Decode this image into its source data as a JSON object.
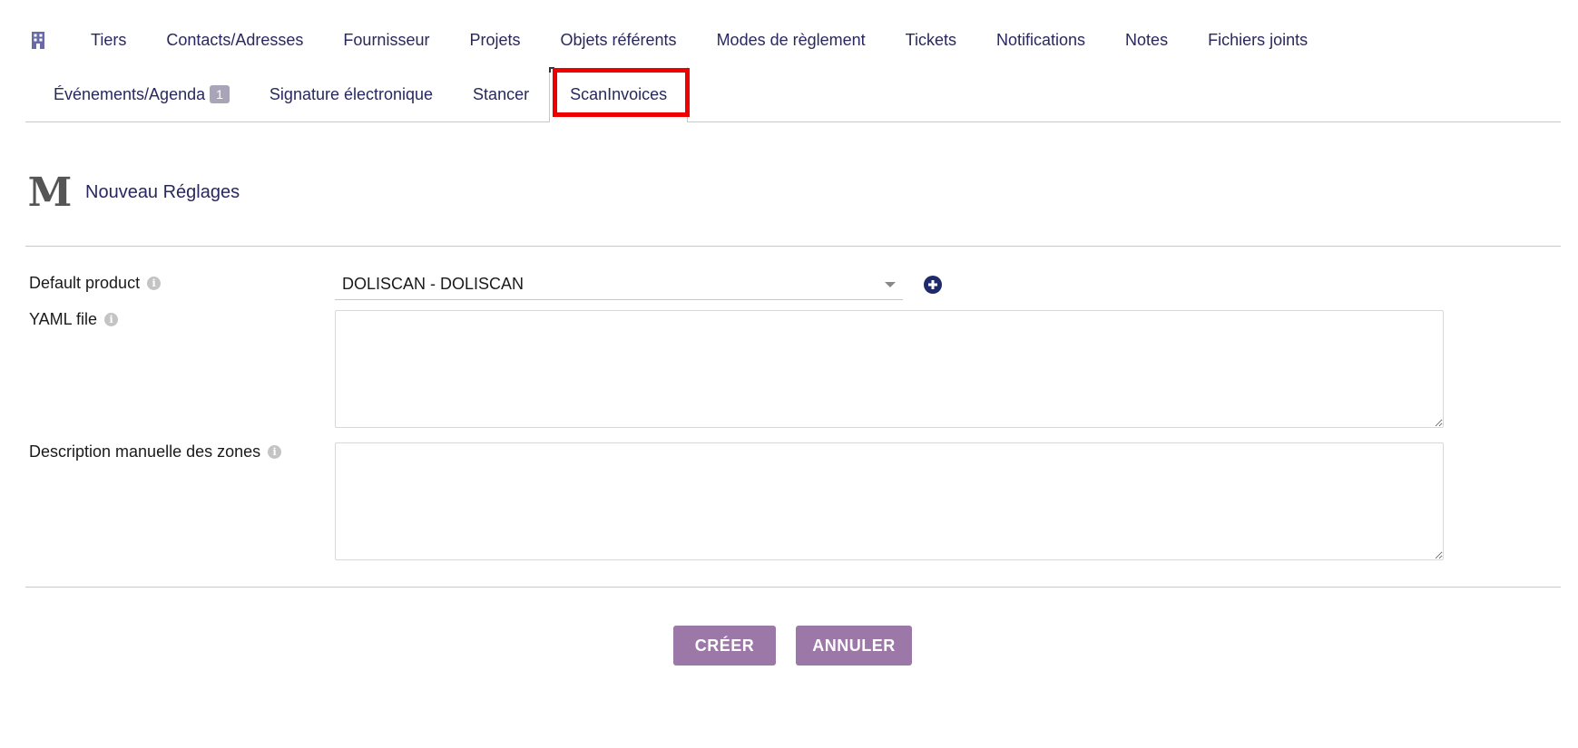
{
  "tabs_row1": [
    {
      "label": "Tiers",
      "name": "tab-tiers"
    },
    {
      "label": "Contacts/Adresses",
      "name": "tab-contacts"
    },
    {
      "label": "Fournisseur",
      "name": "tab-fournisseur"
    },
    {
      "label": "Projets",
      "name": "tab-projets"
    },
    {
      "label": "Objets référents",
      "name": "tab-objets-referents"
    },
    {
      "label": "Modes de règlement",
      "name": "tab-modes-reglement"
    },
    {
      "label": "Tickets",
      "name": "tab-tickets"
    },
    {
      "label": "Notifications",
      "name": "tab-notifications"
    },
    {
      "label": "Notes",
      "name": "tab-notes"
    },
    {
      "label": "Fichiers joints",
      "name": "tab-fichiers-joints"
    }
  ],
  "tabs_row2": {
    "events": {
      "label": "Événements/Agenda",
      "badge": "1"
    },
    "signature": {
      "label": "Signature électronique"
    },
    "stancer": {
      "label": "Stancer"
    },
    "scaninvoices": {
      "label": "ScanInvoices"
    }
  },
  "page": {
    "title": "Nouveau Réglages",
    "logo_letter": "M"
  },
  "form": {
    "default_product_label": "Default product",
    "default_product_value": "DOLISCAN - DOLISCAN",
    "yaml_label": "YAML file",
    "zones_label": "Description manuelle des zones"
  },
  "buttons": {
    "create": "CRÉER",
    "cancel": "ANNULER"
  },
  "colors": {
    "tab_text": "#28285f",
    "button_bg": "#9c78a9",
    "highlight": "#ee0000",
    "badge_bg": "#a9a4b8"
  }
}
